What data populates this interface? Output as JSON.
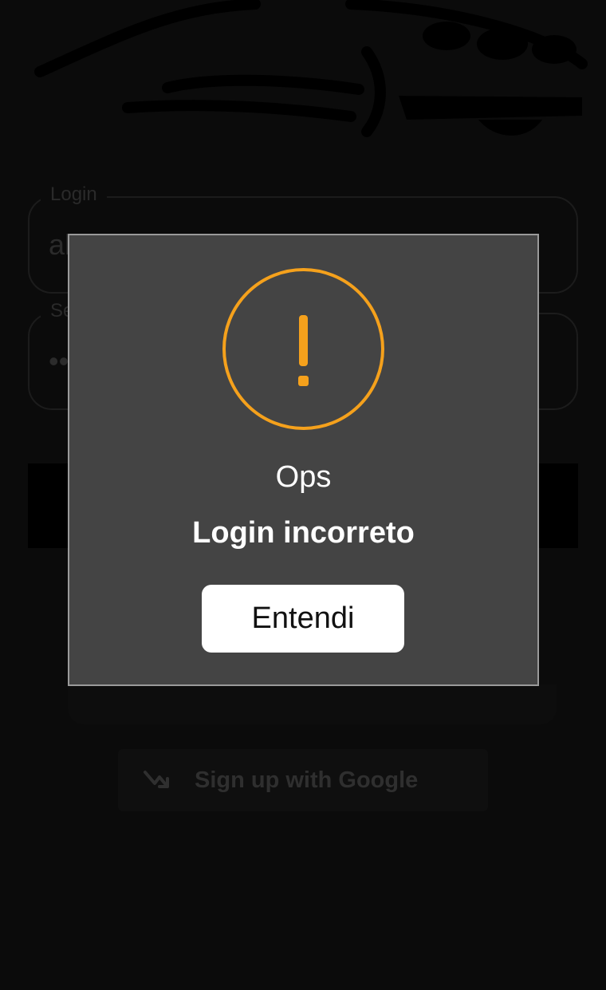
{
  "background_screen": {
    "login_field": {
      "label": "Login",
      "value": "al"
    },
    "password_field": {
      "label": "Se",
      "value": "••"
    },
    "google_button": {
      "label": "Sign up with Google",
      "icon": "trending-up-arrow-icon"
    }
  },
  "dialog": {
    "icon": "warning-icon",
    "title": "Ops",
    "message": "Login incorreto",
    "confirm_label": "Entendi"
  },
  "colors": {
    "background": "#0b0b0b",
    "dialog_background": "#444444",
    "dialog_border": "#9a9a9a",
    "warning_accent": "#f5a11c",
    "button_background": "#ffffff"
  }
}
